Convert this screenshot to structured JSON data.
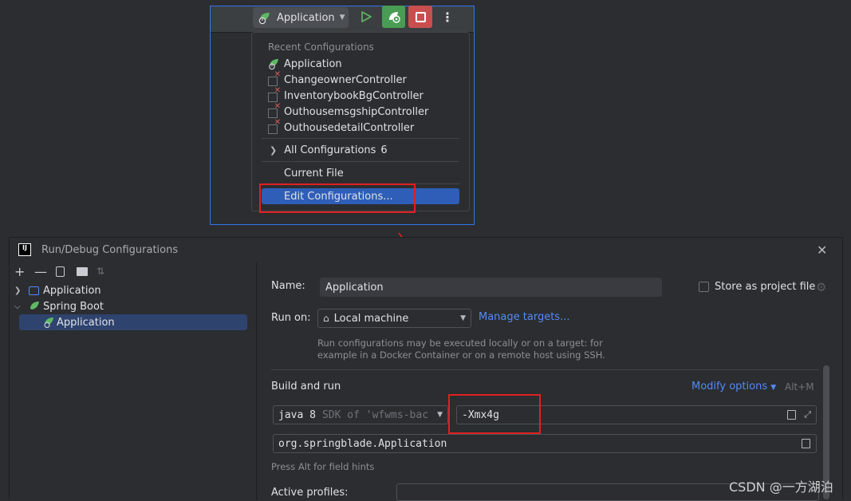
{
  "toolbar": {
    "run_config_label": "Application",
    "run_icon": "play-icon",
    "debug_icon": "debug-icon",
    "stop_icon": "stop-icon",
    "more_icon": "more-vertical-icon",
    "debug_color": "#499c54",
    "stop_color": "#c94f4f"
  },
  "menu": {
    "heading": "Recent Configurations",
    "recent": [
      {
        "label": "Application",
        "icon": "spring-boot-icon"
      },
      {
        "label": "ChangeownerController",
        "icon": "config-error-icon"
      },
      {
        "label": "InventorybookBgController",
        "icon": "config-error-icon"
      },
      {
        "label": "OuthousemsgshipController",
        "icon": "config-error-icon"
      },
      {
        "label": "OuthousedetailController",
        "icon": "config-error-icon"
      }
    ],
    "all_configs_label": "All Configurations",
    "all_configs_count": "6",
    "current_file": "Current File",
    "edit_configs": "Edit Configurations..."
  },
  "dialog": {
    "title": "Run/Debug Configurations",
    "tree": {
      "application_group": "Application",
      "spring_boot_group": "Spring Boot",
      "selected_item": "Application"
    },
    "name_label": "Name:",
    "name_value": "Application",
    "store_label": "Store as project file",
    "run_on_label": "Run on:",
    "run_on_value": "Local machine",
    "manage_targets": "Manage targets...",
    "run_on_hint_1": "Run configurations may be executed locally or on a target: for",
    "run_on_hint_2": "example in a Docker Container or on a remote host using SSH.",
    "build_run_label": "Build and run",
    "modify_options": "Modify options",
    "modify_shortcut": "Alt+M",
    "jdk_value": "java 8",
    "jdk_detail": "SDK of 'wfwms-bac",
    "vm_options_value": "-Xmx4g",
    "main_class_value": "org.springblade.Application",
    "field_hint": "Press Alt for field hints",
    "active_profiles_label": "Active profiles:"
  },
  "watermark": "CSDN @一方湖泊",
  "accent_colors": {
    "highlight": "#2e5eb8",
    "annotation_red": "#e02020",
    "link": "#548af7"
  }
}
